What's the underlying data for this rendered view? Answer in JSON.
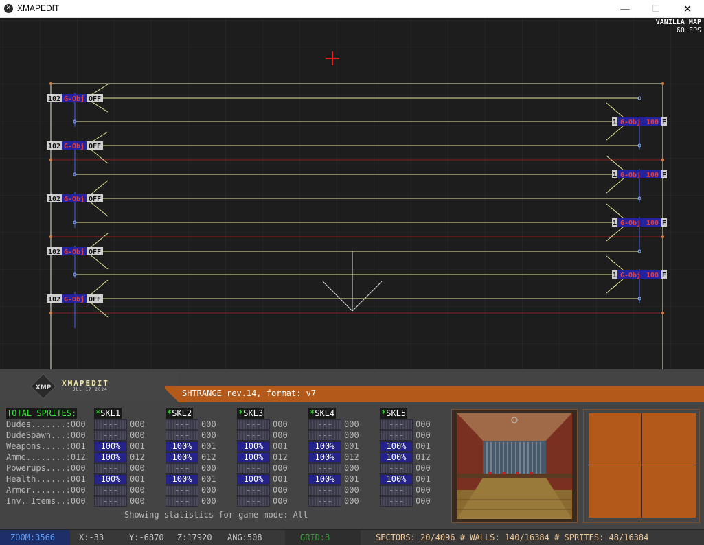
{
  "window": {
    "title": "XMAPEDIT",
    "minimize": "—",
    "maximize": "☐",
    "close": "✕"
  },
  "hud": {
    "map_type": "VANILLA MAP",
    "fps": "60 FPS"
  },
  "sprite_tags": {
    "left_num": "102",
    "name": "G-Obj",
    "state_off": "OFF",
    "right_num": "1",
    "right_val": "100",
    "right_suffix": "F"
  },
  "panel": {
    "logo_name": "XMAPEDIT",
    "logo_date": "JUL 17 2024",
    "logo_emblem_text": "XMP",
    "map_info": "SHTRANGE rev.14, format: v7",
    "stats_header": "TOTAL SPRITES:",
    "rows": [
      {
        "label": "Dudes.......:000"
      },
      {
        "label": "DudeSpawn...:000"
      },
      {
        "label": "Weapons.....:001"
      },
      {
        "label": "Ammo........:012"
      },
      {
        "label": "Powerups....:000"
      },
      {
        "label": "Health......:001"
      },
      {
        "label": "Armor.......:000"
      },
      {
        "label": "Inv. Items..:000"
      }
    ],
    "skills": [
      {
        "name": "SKL1"
      },
      {
        "name": "SKL2"
      },
      {
        "name": "SKL3"
      },
      {
        "name": "SKL4"
      },
      {
        "name": "SKL5"
      }
    ],
    "skill_cells": [
      {
        "pct": "---",
        "count": "000",
        "full": false
      },
      {
        "pct": "---",
        "count": "000",
        "full": false
      },
      {
        "pct": "100%",
        "count": "001",
        "full": true
      },
      {
        "pct": "100%",
        "count": "012",
        "full": true
      },
      {
        "pct": "---",
        "count": "000",
        "full": false
      },
      {
        "pct": "100%",
        "count": "001",
        "full": true
      },
      {
        "pct": "---",
        "count": "000",
        "full": false
      },
      {
        "pct": "---",
        "count": "000",
        "full": false
      }
    ],
    "gamemode": "Showing statistics for game mode: All"
  },
  "statusbar": {
    "zoom": "ZOOM:3566",
    "x": "X:-33",
    "y": "Y:-6870",
    "z": "Z:17920",
    "ang": "ANG:508",
    "grid": "GRID:3",
    "counts": "SECTORS: 20/4096 # WALLS: 140/16384 # SPRITES: 48/16384"
  },
  "colors": {
    "accent_orange": "#b35a1a",
    "wall_yellow": "#e8e89a",
    "wall_red": "#8a2020",
    "grid": "#2a2a2a"
  }
}
